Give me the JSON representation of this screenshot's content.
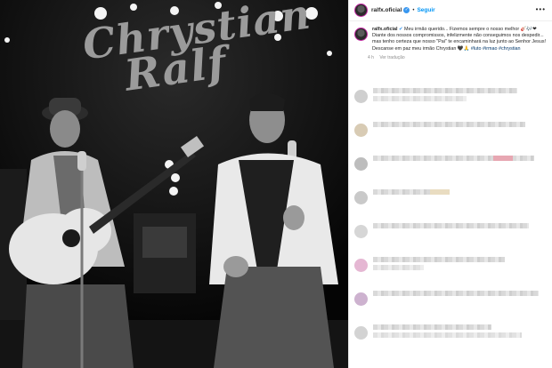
{
  "photo": {
    "sign_line1": "Chrystian",
    "sign_line2": "Ralf"
  },
  "post": {
    "header": {
      "username": "ralfx.oficial",
      "follow_label": "Seguir",
      "separator": "•",
      "more_label": "•••"
    },
    "caption": {
      "username": "ralfx.oficial",
      "text_part1": "Meu irmão querido... Fizemos sempre o nosso melhor",
      "text_part2": "Diante dos nossos compromissos, infelizmente não conseguimos nos despedir... mas tenho certeza que nosso \"Pai\" te encaminhará na luz junto ao Senhor Jesus! Descanse em paz meu irmão Chrystian",
      "hashtags": "#luto #irmao #chrystian",
      "emoji_a": "🎸🎶❤",
      "emoji_b": "🖤🙏",
      "time": "4 h",
      "translation_label": "Ver tradução"
    },
    "comments": [
      {
        "avatar_color": "#cfcfcf",
        "bar1_width": 0.85,
        "bar2_width": 0.55,
        "accent": ""
      },
      {
        "avatar_color": "#d8cbb4",
        "bar1_width": 0.9,
        "bar2_width": 0.0,
        "accent": ""
      },
      {
        "avatar_color": "#bdbdbd",
        "bar1_width": 0.95,
        "bar2_width": 0.0,
        "accent": "#e7a7b2"
      },
      {
        "avatar_color": "#c9c9c9",
        "bar1_width": 0.45,
        "bar2_width": 0.0,
        "accent": "#e9dcc1"
      },
      {
        "avatar_color": "#d6d6d6",
        "bar1_width": 0.92,
        "bar2_width": 0.0,
        "accent": ""
      },
      {
        "avatar_color": "#e5b7d3",
        "bar1_width": 0.78,
        "bar2_width": 0.3,
        "accent": ""
      },
      {
        "avatar_color": "#cdb2cf",
        "bar1_width": 0.98,
        "bar2_width": 0.0,
        "accent": ""
      },
      {
        "avatar_color": "#d3d3d3",
        "bar1_width": 0.7,
        "bar2_width": 0.88,
        "accent": ""
      }
    ]
  }
}
